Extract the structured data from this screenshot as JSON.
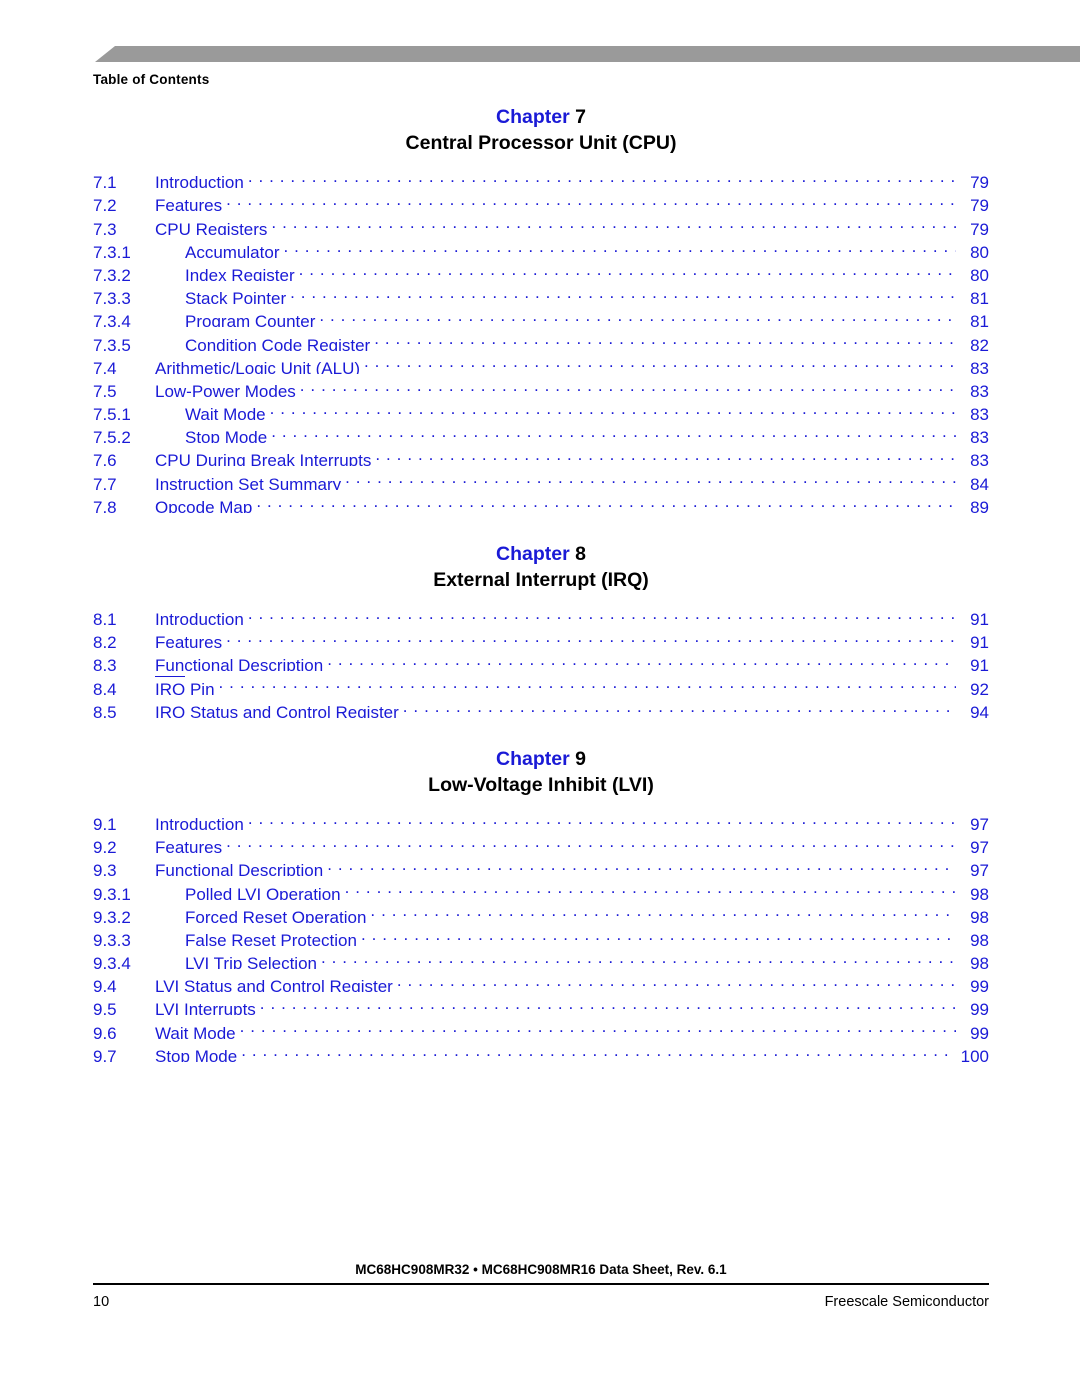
{
  "document": {
    "running_head": "Table of Contents",
    "header_bar_color": "#9a9a9a"
  },
  "colors": {
    "link_blue": "#1a1ad6",
    "body_black": "#000000",
    "rule_gray": "#9a9a9a"
  },
  "sections": [
    {
      "chapter_word": "Chapter",
      "chapter_number": "7",
      "chapter_title": "Central Processor Unit (CPU)",
      "entries": [
        {
          "num": "7.1",
          "label": "Introduction",
          "page": "79",
          "level": 1,
          "overline": ""
        },
        {
          "num": "7.2",
          "label": "Features",
          "page": "79",
          "level": 1,
          "overline": ""
        },
        {
          "num": "7.3",
          "label": "CPU Registers",
          "page": "79",
          "level": 1,
          "overline": ""
        },
        {
          "num": "7.3.1",
          "label": "Accumulator",
          "page": "80",
          "level": 2,
          "overline": ""
        },
        {
          "num": "7.3.2",
          "label": "Index Register",
          "page": "80",
          "level": 2,
          "overline": ""
        },
        {
          "num": "7.3.3",
          "label": "Stack Pointer",
          "page": "81",
          "level": 2,
          "overline": ""
        },
        {
          "num": "7.3.4",
          "label": "Program Counter",
          "page": "81",
          "level": 2,
          "overline": ""
        },
        {
          "num": "7.3.5",
          "label": "Condition Code Register",
          "page": "82",
          "level": 2,
          "overline": ""
        },
        {
          "num": "7.4",
          "label": "Arithmetic/Logic Unit (ALU)",
          "page": "83",
          "level": 1,
          "overline": ""
        },
        {
          "num": "7.5",
          "label": "Low-Power Modes",
          "page": "83",
          "level": 1,
          "overline": ""
        },
        {
          "num": "7.5.1",
          "label": "Wait Mode",
          "page": "83",
          "level": 2,
          "overline": ""
        },
        {
          "num": "7.5.2",
          "label": "Stop Mode",
          "page": "83",
          "level": 2,
          "overline": ""
        },
        {
          "num": "7.6",
          "label": "CPU During Break Interrupts",
          "page": "83",
          "level": 1,
          "overline": ""
        },
        {
          "num": "7.7",
          "label": "Instruction Set Summary",
          "page": "84",
          "level": 1,
          "overline": ""
        },
        {
          "num": "7.8",
          "label": "Opcode Map",
          "page": "89",
          "level": 1,
          "overline": ""
        }
      ]
    },
    {
      "chapter_word": "Chapter",
      "chapter_number": "8",
      "chapter_title": "External Interrupt (IRQ)",
      "entries": [
        {
          "num": "8.1",
          "label": "Introduction",
          "page": "91",
          "level": 1,
          "overline": ""
        },
        {
          "num": "8.2",
          "label": "Features",
          "page": "91",
          "level": 1,
          "overline": ""
        },
        {
          "num": "8.3",
          "label": "Functional Description",
          "page": "91",
          "level": 1,
          "overline": ""
        },
        {
          "num": "8.4",
          "label": " Pin",
          "page": "92",
          "level": 1,
          "overline": "IRQ"
        },
        {
          "num": "8.5",
          "label": "IRQ Status and Control Register",
          "page": "94",
          "level": 1,
          "overline": ""
        }
      ]
    },
    {
      "chapter_word": "Chapter",
      "chapter_number": "9",
      "chapter_title": "Low-Voltage Inhibit (LVI)",
      "entries": [
        {
          "num": "9.1",
          "label": "Introduction",
          "page": "97",
          "level": 1,
          "overline": ""
        },
        {
          "num": "9.2",
          "label": "Features",
          "page": "97",
          "level": 1,
          "overline": ""
        },
        {
          "num": "9.3",
          "label": "Functional Description",
          "page": "97",
          "level": 1,
          "overline": ""
        },
        {
          "num": "9.3.1",
          "label": "Polled LVI Operation",
          "page": "98",
          "level": 2,
          "overline": ""
        },
        {
          "num": "9.3.2",
          "label": "Forced Reset Operation",
          "page": "98",
          "level": 2,
          "overline": ""
        },
        {
          "num": "9.3.3",
          "label": "False Reset Protection",
          "page": "98",
          "level": 2,
          "overline": ""
        },
        {
          "num": "9.3.4",
          "label": "LVI Trip Selection",
          "page": "98",
          "level": 2,
          "overline": ""
        },
        {
          "num": "9.4",
          "label": "LVI Status and Control Register",
          "page": "99",
          "level": 1,
          "overline": ""
        },
        {
          "num": "9.5",
          "label": "LVI Interrupts",
          "page": "99",
          "level": 1,
          "overline": ""
        },
        {
          "num": "9.6",
          "label": "Wait Mode",
          "page": "99",
          "level": 1,
          "overline": ""
        },
        {
          "num": "9.7",
          "label": "Stop Mode",
          "page": "100",
          "level": 1,
          "overline": ""
        }
      ]
    }
  ],
  "footer": {
    "title": "MC68HC908MR32 • MC68HC908MR16 Data Sheet, Rev. 6.1",
    "page_number": "10",
    "brand": "Freescale Semiconductor"
  }
}
